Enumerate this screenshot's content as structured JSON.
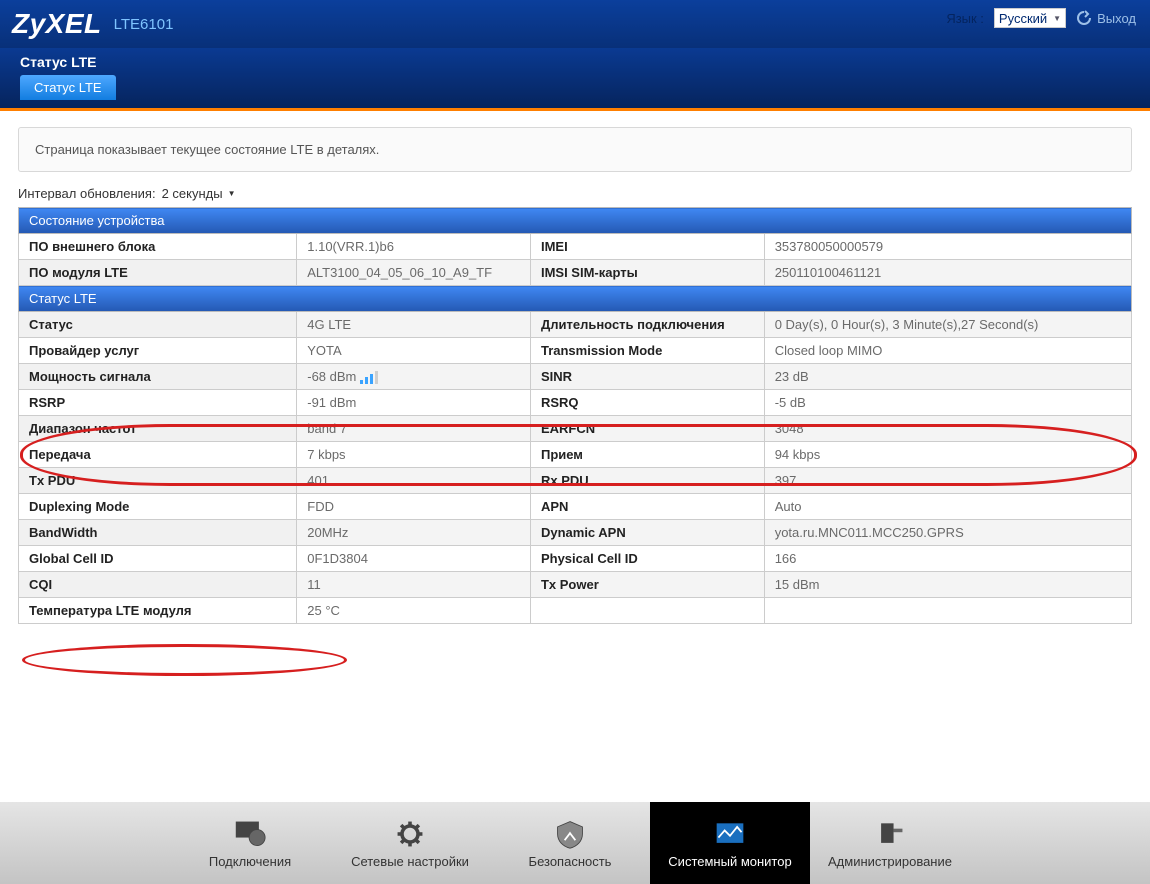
{
  "header": {
    "brand": "ZyXEL",
    "model": "LTE6101",
    "lang_label": "Язык :",
    "lang_value": "Русский",
    "logout": "Выход"
  },
  "page": {
    "title": "Статус LTE",
    "tab": "Статус LTE",
    "description": "Страница показывает текущее состояние LTE в деталях."
  },
  "refresh": {
    "label": "Интервал обновления:",
    "value": "2 секунды"
  },
  "section_titles": {
    "device": "Состояние устройства",
    "lte": "Статус LTE"
  },
  "device_rows": [
    {
      "k1": "ПО внешнего блока",
      "v1": "1.10(VRR.1)b6",
      "k2": "IMEI",
      "v2": "353780050000579"
    },
    {
      "k1": "ПО модуля LTE",
      "v1": "ALT3100_04_05_06_10_A9_TF",
      "k2": "IMSI SIM-карты",
      "v2": "250110100461121"
    }
  ],
  "lte_rows": [
    {
      "k1": "Статус",
      "v1": "4G LTE",
      "k2": "Длительность подключения",
      "v2": "0 Day(s), 0 Hour(s), 3 Minute(s),27 Second(s)"
    },
    {
      "k1": "Провайдер услуг",
      "v1": "YOTA",
      "k2": "Transmission Mode",
      "v2": "Closed loop MIMO"
    },
    {
      "k1": "Мощность сигнала",
      "v1": "-68 dBm",
      "signal": true,
      "k2": "SINR",
      "v2": "23 dB"
    },
    {
      "k1": "RSRP",
      "v1": "-91 dBm",
      "k2": "RSRQ",
      "v2": "-5 dB"
    },
    {
      "k1": "Диапазон частот",
      "v1": "band 7",
      "k2": "EARFCN",
      "v2": "3048"
    },
    {
      "k1": "Передача",
      "v1": "7 kbps",
      "k2": "Прием",
      "v2": "94 kbps"
    },
    {
      "k1": "Tx PDU",
      "v1": "401",
      "k2": "Rx PDU",
      "v2": "397"
    },
    {
      "k1": "Duplexing Mode",
      "v1": "FDD",
      "k2": "APN",
      "v2": "Auto"
    },
    {
      "k1": "BandWidth",
      "v1": "20MHz",
      "k2": "Dynamic APN",
      "v2": "yota.ru.MNC011.MCC250.GPRS"
    },
    {
      "k1": "Global Cell ID",
      "v1": "0F1D3804",
      "k2": "Physical Cell ID",
      "v2": "166"
    },
    {
      "k1": "CQI",
      "v1": "11",
      "k2": "Tx Power",
      "v2": "15 dBm"
    },
    {
      "k1": "Температура LTE модуля",
      "v1": "25 °C",
      "k2": "",
      "v2": ""
    }
  ],
  "nav": {
    "items": [
      {
        "label": "Подключения"
      },
      {
        "label": "Сетевые настройки"
      },
      {
        "label": "Безопасность"
      },
      {
        "label": "Системный монитор"
      },
      {
        "label": "Администрирование"
      }
    ]
  }
}
